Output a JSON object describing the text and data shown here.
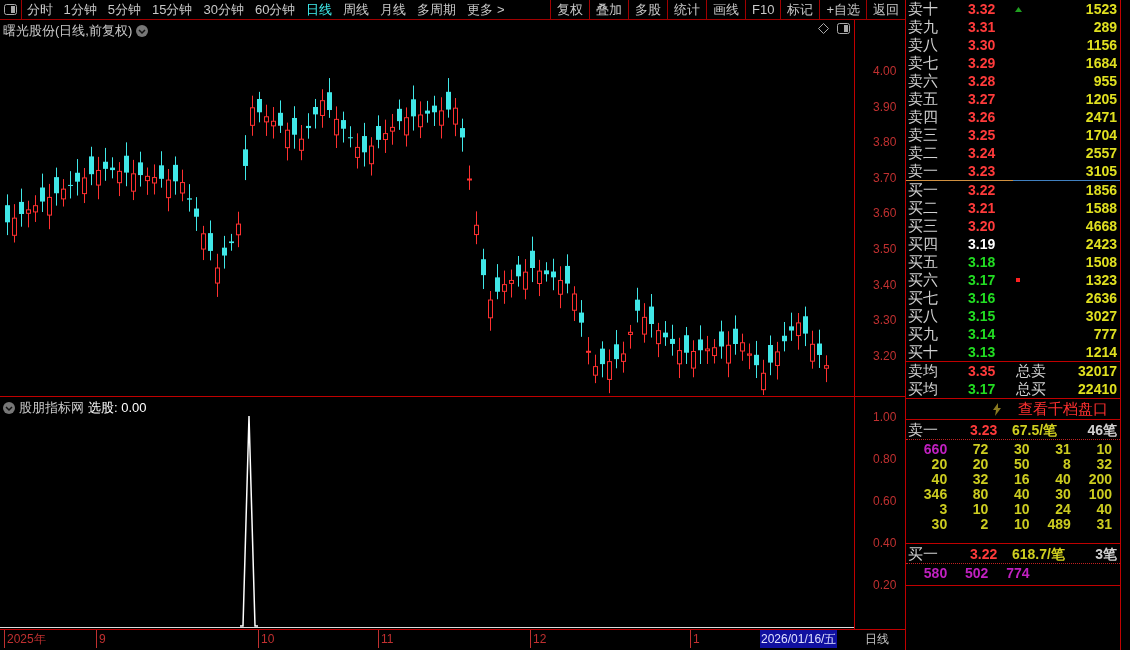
{
  "toolbar": {
    "periods": [
      {
        "label": "分时",
        "selected": false
      },
      {
        "label": "1分钟",
        "selected": false
      },
      {
        "label": "5分钟",
        "selected": false
      },
      {
        "label": "15分钟",
        "selected": false
      },
      {
        "label": "30分钟",
        "selected": false
      },
      {
        "label": "60分钟",
        "selected": false
      },
      {
        "label": "日线",
        "selected": true
      },
      {
        "label": "周线",
        "selected": false
      },
      {
        "label": "月线",
        "selected": false
      },
      {
        "label": "多周期",
        "selected": false
      },
      {
        "label": "更多 >",
        "selected": false
      }
    ],
    "buttons": [
      "复权",
      "叠加",
      "多股",
      "统计",
      "画线",
      "F10",
      "标记",
      "+自选",
      "返回"
    ]
  },
  "main_chart": {
    "title": "曙光股份(日线,前复权)",
    "price_ticks": [
      "4.00",
      "3.90",
      "3.80",
      "3.70",
      "3.60",
      "3.50",
      "3.40",
      "3.30",
      "3.20"
    ]
  },
  "indicator": {
    "name": "股朋指标网",
    "reading": "选股: 0.00",
    "ticks": [
      "1.00",
      "0.80",
      "0.60",
      "0.40",
      "0.20"
    ]
  },
  "time_axis": {
    "labels": [
      "2025年",
      "9",
      "10",
      "11",
      "12",
      "1"
    ],
    "current_date": "2026/01/16/五",
    "period": "日线"
  },
  "order_book": {
    "asks": [
      {
        "label": "卖十",
        "price": "3.32",
        "volume": "1523",
        "color": "#ff3b3b",
        "uptick": true
      },
      {
        "label": "卖九",
        "price": "3.31",
        "volume": "289",
        "color": "#ff3b3b",
        "uptick": false
      },
      {
        "label": "卖八",
        "price": "3.30",
        "volume": "1156",
        "color": "#ff3b3b",
        "uptick": false
      },
      {
        "label": "卖七",
        "price": "3.29",
        "volume": "1684",
        "color": "#ff3b3b",
        "uptick": false
      },
      {
        "label": "卖六",
        "price": "3.28",
        "volume": "955",
        "color": "#ff3b3b",
        "uptick": false
      },
      {
        "label": "卖五",
        "price": "3.27",
        "volume": "1205",
        "color": "#ff3b3b",
        "uptick": false
      },
      {
        "label": "卖四",
        "price": "3.26",
        "volume": "2471",
        "color": "#ff3b3b",
        "uptick": false
      },
      {
        "label": "卖三",
        "price": "3.25",
        "volume": "1704",
        "color": "#ff3b3b",
        "uptick": false
      },
      {
        "label": "卖二",
        "price": "3.24",
        "volume": "2557",
        "color": "#ff3b3b",
        "uptick": false
      },
      {
        "label": "卖一",
        "price": "3.23",
        "volume": "3105",
        "color": "#ff3b3b",
        "uptick": false
      }
    ],
    "bids": [
      {
        "label": "买一",
        "price": "3.22",
        "volume": "1856",
        "color": "#ff3b3b",
        "flagged": false
      },
      {
        "label": "买二",
        "price": "3.21",
        "volume": "1588",
        "color": "#ff3b3b",
        "flagged": false
      },
      {
        "label": "买三",
        "price": "3.20",
        "volume": "4668",
        "color": "#ff3b3b",
        "flagged": false
      },
      {
        "label": "买四",
        "price": "3.19",
        "volume": "2423",
        "color": "#ffffff",
        "flagged": false
      },
      {
        "label": "买五",
        "price": "3.18",
        "volume": "1508",
        "color": "#22dd22",
        "flagged": false
      },
      {
        "label": "买六",
        "price": "3.17",
        "volume": "1323",
        "color": "#22dd22",
        "flagged": true
      },
      {
        "label": "买七",
        "price": "3.16",
        "volume": "2636",
        "color": "#22dd22",
        "flagged": false
      },
      {
        "label": "买八",
        "price": "3.15",
        "volume": "3027",
        "color": "#22dd22",
        "flagged": false
      },
      {
        "label": "买九",
        "price": "3.14",
        "volume": "777",
        "color": "#22dd22",
        "flagged": false
      },
      {
        "label": "买十",
        "price": "3.13",
        "volume": "1214",
        "color": "#22dd22",
        "flagged": false
      }
    ],
    "summary": [
      {
        "label": "卖均",
        "price": "3.35",
        "color": "#ff3b3b",
        "total_label": "总卖",
        "total": "32017"
      },
      {
        "label": "买均",
        "price": "3.17",
        "color": "#22dd22",
        "total_label": "总买",
        "total": "22410"
      }
    ],
    "depth_link": "查看千档盘口",
    "queues": [
      {
        "label": "卖一",
        "price": "3.23",
        "average": "67.5/笔",
        "count": "46笔",
        "cells": [
          {
            "text": "660",
            "color": "#c020c0"
          },
          {
            "text": "72",
            "color": "#cccc20"
          },
          {
            "text": "30",
            "color": "#cccc20"
          },
          {
            "text": "31",
            "color": "#cccc20"
          },
          {
            "text": "10",
            "color": "#cccc20"
          },
          {
            "text": "20",
            "color": "#cccc20"
          },
          {
            "text": "20",
            "color": "#cccc20"
          },
          {
            "text": "50",
            "color": "#cccc20"
          },
          {
            "text": "8",
            "color": "#cccc20"
          },
          {
            "text": "32",
            "color": "#cccc20"
          },
          {
            "text": "40",
            "color": "#cccc20"
          },
          {
            "text": "32",
            "color": "#cccc20"
          },
          {
            "text": "16",
            "color": "#cccc20"
          },
          {
            "text": "40",
            "color": "#cccc20"
          },
          {
            "text": "200",
            "color": "#cccc20"
          },
          {
            "text": "346",
            "color": "#cccc20"
          },
          {
            "text": "80",
            "color": "#cccc20"
          },
          {
            "text": "40",
            "color": "#cccc20"
          },
          {
            "text": "30",
            "color": "#cccc20"
          },
          {
            "text": "100",
            "color": "#cccc20"
          },
          {
            "text": "3",
            "color": "#cccc20"
          },
          {
            "text": "10",
            "color": "#cccc20"
          },
          {
            "text": "10",
            "color": "#cccc20"
          },
          {
            "text": "24",
            "color": "#cccc20"
          },
          {
            "text": "40",
            "color": "#cccc20"
          },
          {
            "text": "30",
            "color": "#cccc20"
          },
          {
            "text": "2",
            "color": "#cccc20"
          },
          {
            "text": "10",
            "color": "#cccc20"
          },
          {
            "text": "489",
            "color": "#cccc20"
          },
          {
            "text": "31",
            "color": "#cccc20"
          }
        ]
      },
      {
        "label": "买一",
        "price": "3.22",
        "average": "618.7/笔",
        "count": "3笔",
        "cells": [
          {
            "text": "580",
            "color": "#c020c0"
          },
          {
            "text": "502",
            "color": "#c020c0"
          },
          {
            "text": "774",
            "color": "#c020c0"
          }
        ]
      }
    ]
  }
}
